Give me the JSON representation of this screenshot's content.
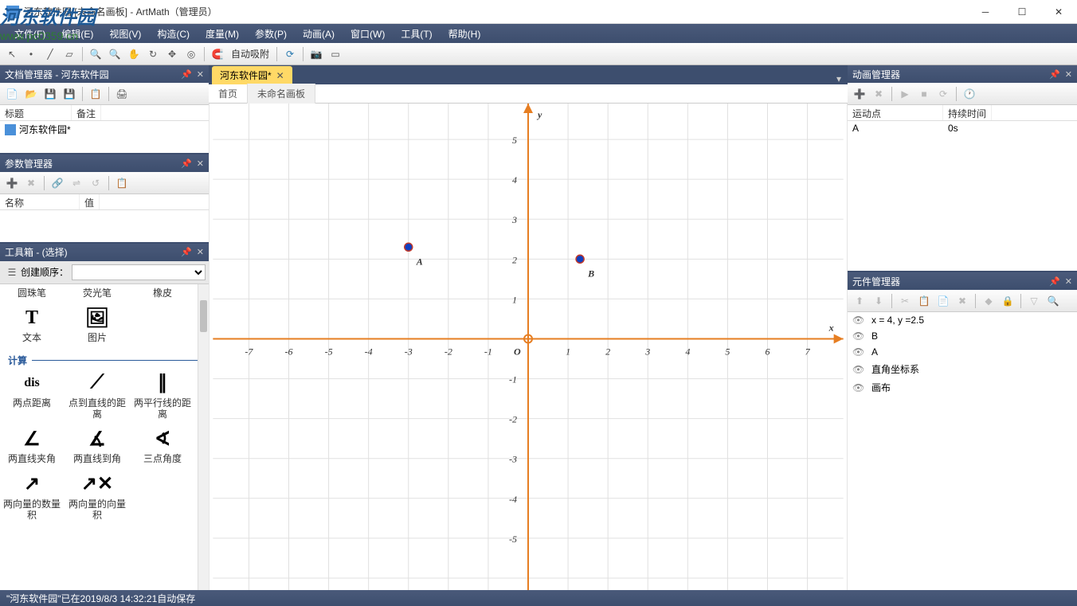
{
  "titlebar": {
    "text": "河东软件园 [未命名画板] - ArtMath（管理员）"
  },
  "watermark": {
    "logo": "河东软件园",
    "url": "www.pc0359.cn"
  },
  "menu": {
    "file": "文件(F)",
    "edit": "编辑(E)",
    "view": "视图(V)",
    "construct": "构造(C)",
    "measure": "度量(M)",
    "param": "参数(P)",
    "anim": "动画(A)",
    "window": "窗口(W)",
    "tool": "工具(T)",
    "help": "帮助(H)"
  },
  "toolbar": {
    "autosnap": "自动吸附"
  },
  "docmgr": {
    "title": "文档管理器 - 河东软件园",
    "col_title": "标题",
    "col_note": "备注",
    "items": [
      {
        "name": "河东软件园*"
      }
    ]
  },
  "parammgr": {
    "title": "参数管理器",
    "col_name": "名称",
    "col_value": "值"
  },
  "toolbox": {
    "title": "工具箱 - (选择)",
    "order_label": "创建顺序：",
    "row0": {
      "a": "圆珠笔",
      "b": "荧光笔",
      "c": "橡皮"
    },
    "row1": {
      "a": "文本",
      "b": "图片"
    },
    "cat_calc": "计算",
    "row2": {
      "a": "两点距离",
      "b": "点到直线的距离",
      "c": "两平行线的距离"
    },
    "row3": {
      "a": "两直线夹角",
      "b": "两直线到角",
      "c": "三点角度"
    },
    "row4": {
      "a": "两向量的数量积",
      "b": "两向量的向量积"
    }
  },
  "doctab": {
    "name": "河东软件园*",
    "sub_home": "首页",
    "sub_board": "未命名画板"
  },
  "animmgr": {
    "title": "动画管理器",
    "col_point": "运动点",
    "col_duration": "持续时间",
    "items": [
      {
        "point": "A",
        "duration": "0s"
      }
    ]
  },
  "elemmgr": {
    "title": "元件管理器",
    "items": [
      {
        "label": "x = 4, y =2.5"
      },
      {
        "label": "B"
      },
      {
        "label": "A"
      },
      {
        "label": "直角坐标系"
      },
      {
        "label": "画布"
      }
    ]
  },
  "statusbar": {
    "text": "\"河东软件园\"已在2019/8/3 14:32:21自动保存"
  },
  "chart_data": {
    "type": "scatter",
    "title": "",
    "xlabel": "x",
    "ylabel": "y",
    "xlim": [
      -7,
      7
    ],
    "ylim": [
      -5,
      5
    ],
    "xticks": [
      -7,
      -6,
      -5,
      -4,
      -3,
      -2,
      -1,
      1,
      2,
      3,
      4,
      5,
      6,
      7
    ],
    "yticks": [
      -5,
      -4,
      -3,
      -2,
      -1,
      1,
      2,
      3,
      4,
      5
    ],
    "origin_label": "O",
    "series": [
      {
        "name": "A",
        "x": -3,
        "y": 2.3
      },
      {
        "name": "B",
        "x": 1.3,
        "y": 2.0
      }
    ]
  }
}
